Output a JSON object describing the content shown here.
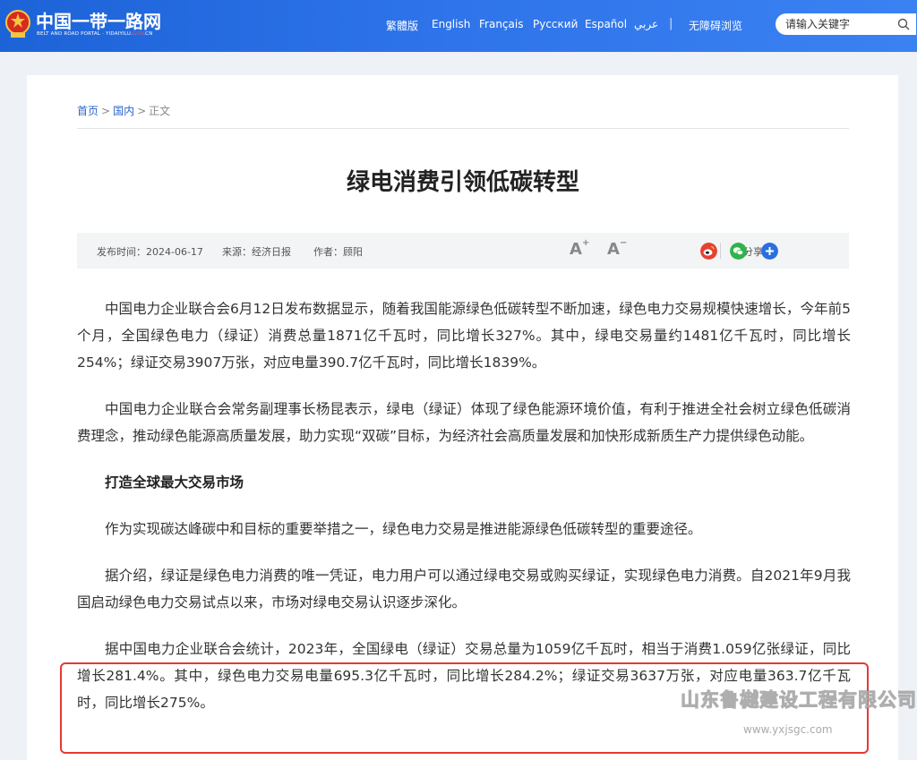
{
  "header": {
    "logo_title": "中国一带一路网",
    "logo_sub_pre": "BELT AND ROAD PORTAL · YIDAIYILU.",
    "logo_sub_red": "GOV",
    "logo_sub_post": ".CN",
    "nav": [
      "繁體版",
      "English",
      "Français",
      "Русский",
      "Español",
      "عربي"
    ],
    "separator": "|",
    "accessibility": "无障碍浏览",
    "search_placeholder": "请输入关键字",
    "colors": {
      "bar": "#2f74ea"
    }
  },
  "breadcrumb": {
    "home": "首页",
    "section": "国内",
    "current": "正文",
    "sep": ">"
  },
  "article": {
    "title": "绿电消费引领低碳转型",
    "published": "发布时间：2024-06-17",
    "source": "来源：经济日报",
    "author": "作者：顾阳",
    "font_increase": "A",
    "font_increase_mark": "+",
    "font_decrease": "A",
    "font_decrease_mark": "−",
    "share_label": "分享：",
    "share_icons": [
      "weibo-icon",
      "wechat-icon",
      "more-share-icon"
    ],
    "paragraphs": [
      "中国电力企业联合会6月12日发布数据显示，随着我国能源绿色低碳转型不断加速，绿色电力交易规模快速增长，今年前5个月，全国绿色电力（绿证）消费总量1871亿千瓦时，同比增长327%。其中，绿电交易量约1481亿千瓦时，同比增长254%；绿证交易3907万张，对应电量390.7亿千瓦时，同比增长1839%。",
      "中国电力企业联合会常务副理事长杨昆表示，绿电（绿证）体现了绿色能源环境价值，有利于推进全社会树立绿色低碳消费理念，推动绿色能源高质量发展，助力实现“双碳”目标，为经济社会高质量发展和加快形成新质生产力提供绿色动能。"
    ],
    "subheading": "打造全球最大交易市场",
    "paragraphs2": [
      "作为实现碳达峰碳中和目标的重要举措之一，绿色电力交易是推进能源绿色低碳转型的重要途径。",
      "据介绍，绿证是绿色电力消费的唯一凭证，电力用户可以通过绿电交易或购买绿证，实现绿色电力消费。自2021年9月我国启动绿色电力交易试点以来，市场对绿电交易认识逐步深化。",
      "据中国电力企业联合会统计，2023年，全国绿电（绿证）交易总量为1059亿千瓦时，相当于消费1.059亿张绿证，同比增长281.4%。其中，绿色电力交易电量695.3亿千瓦时，同比增长284.2%；绿证交易3637万张，对应电量363.7亿千瓦时，同比增长275%。"
    ]
  },
  "watermark": {
    "text": "山东鲁樾建设工程有限公司",
    "url": "www.yxjsgc.com"
  }
}
